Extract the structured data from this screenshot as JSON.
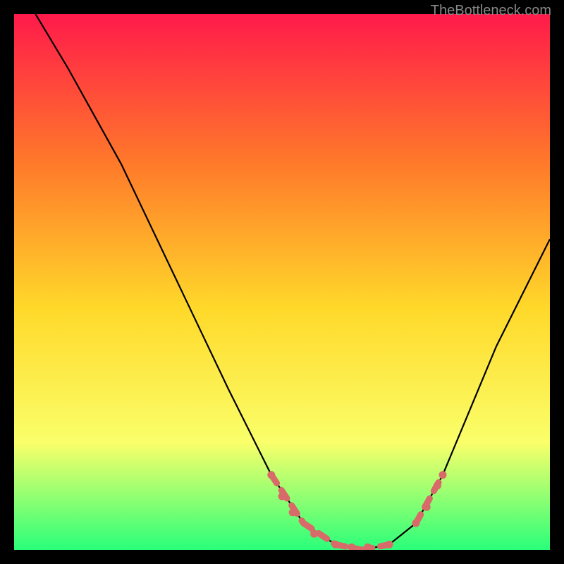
{
  "watermark": "TheBottleneck.com",
  "chart_data": {
    "type": "line",
    "title": "",
    "xlabel": "",
    "ylabel": "",
    "xlim": [
      0,
      100
    ],
    "ylim": [
      0,
      100
    ],
    "background_gradient": {
      "top": "#ff1a4a",
      "upper_mid": "#ff7a2a",
      "mid": "#ffd92a",
      "lower_mid": "#faff6a",
      "bottom": "#2aff7a"
    },
    "series": [
      {
        "name": "bottleneck-curve",
        "color": "#000000",
        "x": [
          4,
          10,
          20,
          30,
          40,
          48,
          54,
          60,
          65,
          70,
          75,
          80,
          85,
          90,
          96,
          100
        ],
        "y": [
          100,
          90,
          72,
          51,
          30,
          14,
          5,
          1,
          0,
          1,
          5,
          14,
          26,
          38,
          50,
          58
        ]
      }
    ],
    "markers": {
      "name": "highlighted-range",
      "color": "#d86a6a",
      "segments": [
        {
          "x1": 48,
          "y1": 14,
          "x2": 54,
          "y2": 5
        },
        {
          "x1": 54,
          "y1": 5,
          "x2": 60,
          "y2": 1
        },
        {
          "x1": 60,
          "y1": 1,
          "x2": 65,
          "y2": 0
        },
        {
          "x1": 65,
          "y1": 0,
          "x2": 70,
          "y2": 1
        },
        {
          "x1": 75,
          "y1": 5,
          "x2": 80,
          "y2": 14
        }
      ],
      "points": [
        {
          "x": 48,
          "y": 14
        },
        {
          "x": 50,
          "y": 10
        },
        {
          "x": 52,
          "y": 7
        },
        {
          "x": 56,
          "y": 3
        },
        {
          "x": 60,
          "y": 1
        },
        {
          "x": 63,
          "y": 0.5
        },
        {
          "x": 66,
          "y": 0.5
        },
        {
          "x": 70,
          "y": 1
        },
        {
          "x": 75,
          "y": 5
        },
        {
          "x": 77,
          "y": 8
        },
        {
          "x": 79,
          "y": 12
        },
        {
          "x": 80,
          "y": 14
        }
      ]
    }
  }
}
